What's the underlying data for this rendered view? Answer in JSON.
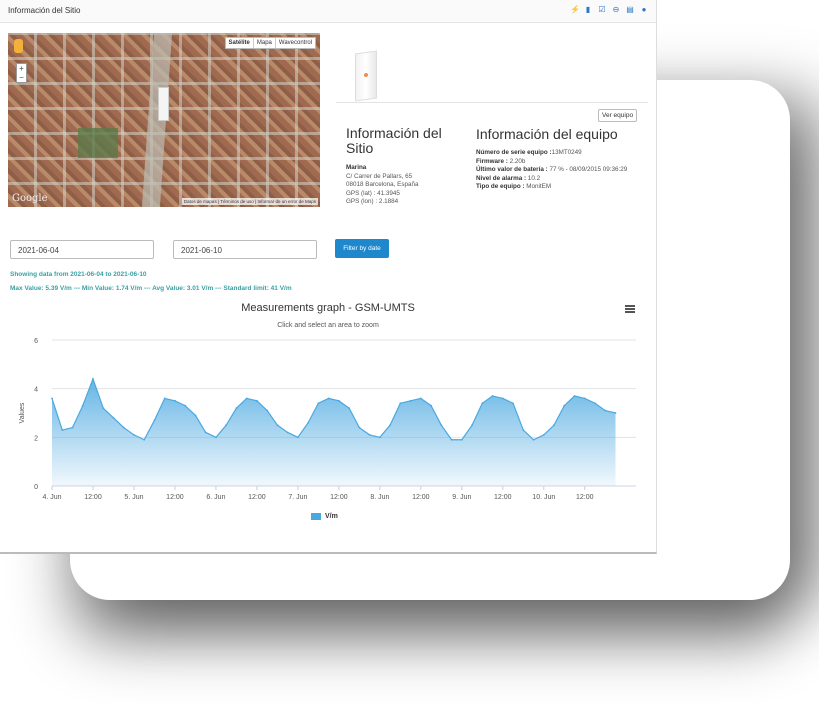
{
  "header": {
    "title": "Información del Sitio",
    "icons": [
      "bolt-icon",
      "chart-icon",
      "check-square-icon",
      "minus-circle-icon",
      "document-icon",
      "user-icon"
    ]
  },
  "map": {
    "tabs": [
      "Satélite",
      "Mapa",
      "Wavecontrol"
    ],
    "active_tab": "Satélite",
    "zoom_in": "+",
    "zoom_out": "−",
    "logo": "Google",
    "attribution": "Datos de mapas | Términos de uso | Informar de un error de Maps"
  },
  "ver_equipo": "Ver equipo",
  "site": {
    "title": "Información del Sitio",
    "name": "Marina",
    "address1": "C/ Carrer de Pallars, 65",
    "address2": "08018 Barcelona, España",
    "gps_lat": "GPS (lat) : 41.3945",
    "gps_lon": "GPS (lon) : 2.1884"
  },
  "equipment": {
    "title": "Información del equipo",
    "serial_label": "Número de serie equipo :",
    "serial_value": "13MT0249",
    "firmware_label": "Firmware :",
    "firmware_value": " 2.20b",
    "battery_label": "Último valor de batería :",
    "battery_value": " 77 % - 08/09/2015 09:36:29",
    "alarm_label": "Nivel de alarma :",
    "alarm_value": " 10.2",
    "type_label": "Tipo de equipo :",
    "type_value": " MonitEM"
  },
  "filter": {
    "from": "2021-06-04",
    "to": "2021-06-10",
    "button": "Filter by date",
    "showing": "Showing data from 2021-06-04 to 2021-06-10",
    "stats": "Max Value: 5.39 V/m --- Min Value: 1.74 V/m --- Avg Value: 3.01 V/m --- Standard limit: 41 V/m"
  },
  "chart_data": {
    "type": "area",
    "title": "Measurements graph - GSM-UMTS",
    "subtitle": "Click and select an area to zoom",
    "ylabel": "Values",
    "xlabel": "",
    "ylim": [
      0,
      6
    ],
    "yticks": [
      0,
      2,
      4,
      6
    ],
    "xticks": [
      "4. Jun",
      "12:00",
      "5. Jun",
      "12:00",
      "6. Jun",
      "12:00",
      "7. Jun",
      "12:00",
      "8. Jun",
      "12:00",
      "9. Jun",
      "12:00",
      "10. Jun",
      "12:00"
    ],
    "grid": true,
    "legend_position": "bottom",
    "series": [
      {
        "name": "V/m",
        "color": "#4aa8e0",
        "x": [
          "2021-06-04 00:00",
          "2021-06-04 03:00",
          "2021-06-04 06:00",
          "2021-06-04 09:00",
          "2021-06-04 12:00",
          "2021-06-04 15:00",
          "2021-06-04 18:00",
          "2021-06-04 21:00",
          "2021-06-05 00:00",
          "2021-06-05 03:00",
          "2021-06-05 06:00",
          "2021-06-05 09:00",
          "2021-06-05 12:00",
          "2021-06-05 15:00",
          "2021-06-05 18:00",
          "2021-06-05 21:00",
          "2021-06-06 00:00",
          "2021-06-06 03:00",
          "2021-06-06 06:00",
          "2021-06-06 09:00",
          "2021-06-06 12:00",
          "2021-06-06 15:00",
          "2021-06-06 18:00",
          "2021-06-06 21:00",
          "2021-06-07 00:00",
          "2021-06-07 03:00",
          "2021-06-07 06:00",
          "2021-06-07 09:00",
          "2021-06-07 12:00",
          "2021-06-07 15:00",
          "2021-06-07 18:00",
          "2021-06-07 21:00",
          "2021-06-08 00:00",
          "2021-06-08 03:00",
          "2021-06-08 06:00",
          "2021-06-08 09:00",
          "2021-06-08 12:00",
          "2021-06-08 15:00",
          "2021-06-08 18:00",
          "2021-06-08 21:00",
          "2021-06-09 00:00",
          "2021-06-09 03:00",
          "2021-06-09 06:00",
          "2021-06-09 09:00",
          "2021-06-09 12:00",
          "2021-06-09 15:00",
          "2021-06-09 18:00",
          "2021-06-09 21:00",
          "2021-06-10 00:00",
          "2021-06-10 03:00",
          "2021-06-10 06:00",
          "2021-06-10 09:00",
          "2021-06-10 12:00",
          "2021-06-10 15:00",
          "2021-06-10 18:00",
          "2021-06-10 21:00"
        ],
        "values": [
          3.6,
          2.3,
          2.4,
          3.3,
          4.4,
          3.2,
          2.8,
          2.4,
          2.1,
          1.9,
          2.7,
          3.6,
          3.5,
          3.3,
          2.9,
          2.2,
          2.0,
          2.5,
          3.2,
          3.6,
          3.5,
          3.1,
          2.5,
          2.2,
          2.0,
          2.6,
          3.4,
          3.6,
          3.5,
          3.2,
          2.4,
          2.1,
          2.0,
          2.5,
          3.4,
          3.5,
          3.6,
          3.3,
          2.5,
          1.9,
          1.9,
          2.5,
          3.4,
          3.7,
          3.6,
          3.4,
          2.3,
          1.9,
          2.1,
          2.5,
          3.3,
          3.7,
          3.6,
          3.4,
          3.1,
          3.0
        ]
      }
    ]
  }
}
